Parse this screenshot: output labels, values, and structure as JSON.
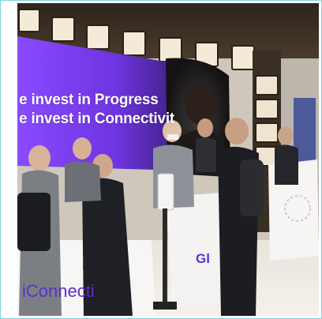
{
  "photo": {
    "alt": "",
    "screen": {
      "line1": "e invest in Progress",
      "line2": "e invest in Connectivit"
    },
    "counter_front": {
      "text": "iConnecti"
    },
    "counter_side": {
      "text": "Gl"
    }
  },
  "colors": {
    "frame": "#7fd3dd",
    "screen_purple": "#7a3cf0",
    "ceiling": "#3a2f25"
  }
}
